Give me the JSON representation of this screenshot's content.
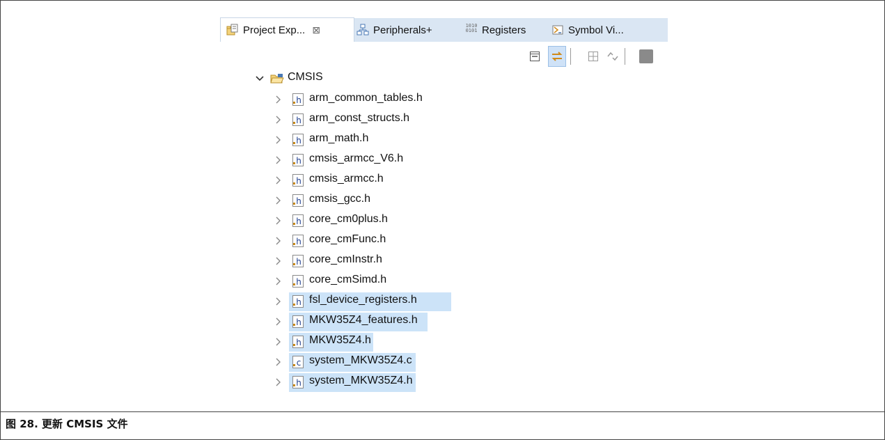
{
  "tabs": [
    {
      "label": "Project Exp...",
      "icon": "project-explorer-icon",
      "close": "⊠"
    },
    {
      "label": "Peripherals+",
      "icon": "peripherals-icon"
    },
    {
      "label": "Registers",
      "icon": "registers-icon",
      "icon_text": "1010\n0101"
    },
    {
      "label": "Symbol Vi...",
      "icon": "symbol-viewer-icon"
    }
  ],
  "toolbar": [
    "collapse-all-icon",
    "link-with-editor-icon",
    "filter-icon",
    "sync-icon",
    "view-menu-icon"
  ],
  "tree": {
    "root": {
      "label": "CMSIS",
      "icon": "folder-open-icon",
      "expanded": true
    },
    "items": [
      {
        "label": "arm_common_tables.h",
        "type": "h",
        "selected": false
      },
      {
        "label": "arm_const_structs.h",
        "type": "h",
        "selected": false
      },
      {
        "label": "arm_math.h",
        "type": "h",
        "selected": false
      },
      {
        "label": "cmsis_armcc_V6.h",
        "type": "h",
        "selected": false
      },
      {
        "label": "cmsis_armcc.h",
        "type": "h",
        "selected": false
      },
      {
        "label": "cmsis_gcc.h",
        "type": "h",
        "selected": false
      },
      {
        "label": "core_cm0plus.h",
        "type": "h",
        "selected": false
      },
      {
        "label": "core_cmFunc.h",
        "type": "h",
        "selected": false
      },
      {
        "label": "core_cmInstr.h",
        "type": "h",
        "selected": false
      },
      {
        "label": "core_cmSimd.h",
        "type": "h",
        "selected": false
      },
      {
        "label": "fsl_device_registers.h",
        "type": "h",
        "selected": true
      },
      {
        "label": "MKW35Z4_features.h",
        "type": "h",
        "selected": true
      },
      {
        "label": "MKW35Z4.h",
        "type": "h",
        "selected": true
      },
      {
        "label": "system_MKW35Z4.c",
        "type": "c",
        "selected": true
      },
      {
        "label": "system_MKW35Z4.h",
        "type": "h",
        "selected": true
      }
    ]
  },
  "caption": "图 28. 更新 CMSIS 文件"
}
